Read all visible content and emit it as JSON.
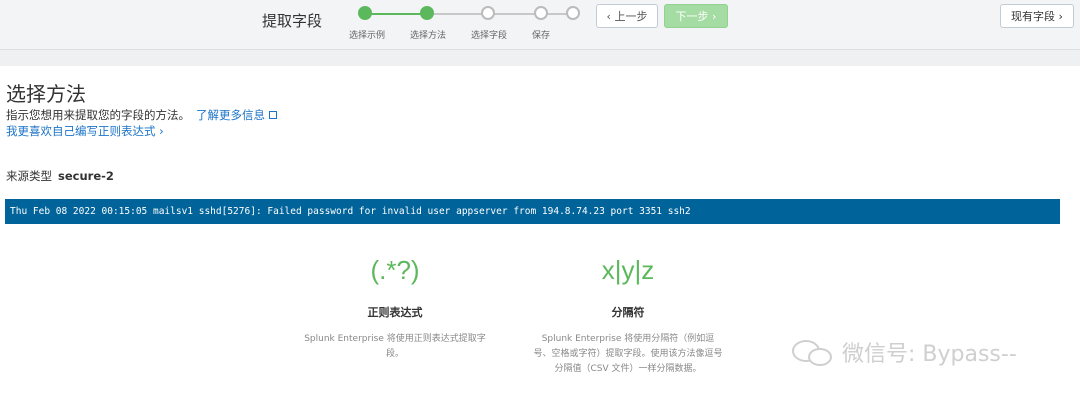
{
  "wizard": {
    "title": "提取字段",
    "steps": [
      {
        "label": "选择示例",
        "done": true
      },
      {
        "label": "选择方法",
        "done": true
      },
      {
        "label": "选择字段",
        "done": false
      },
      {
        "label": "保存",
        "done": false
      }
    ],
    "prev_label": "‹ 上一步",
    "next_label": "下一步 ›",
    "existing_fields_label": "现有字段 ›"
  },
  "page": {
    "title": "选择方法",
    "description": "指示您想用来提取您的字段的方法。",
    "learn_more": "了解更多信息",
    "regex_link": "我更喜欢自己编写正则表达式 ›"
  },
  "source": {
    "label": "来源类型",
    "value": "secure-2"
  },
  "sample_event": "Thu Feb 08 2022 00:15:05 mailsv1 sshd[5276]: Failed password for invalid user appserver from 194.8.74.23 port 3351 ssh2",
  "methods": [
    {
      "icon": "(.*?)",
      "name": "正则表达式",
      "description": "Splunk Enterprise 将使用正则表达式提取字段。"
    },
    {
      "icon": "x|y|z",
      "name": "分隔符",
      "description": "Splunk Enterprise 将使用分隔符（例如逗号、空格或字符）提取字段。使用该方法像逗号分隔值（CSV 文件）一样分隔数据。"
    }
  ],
  "watermark": "微信号: Bypass--",
  "colors": {
    "accent_green": "#5cb85c",
    "link_blue": "#1a73c7",
    "sample_bg": "#00639a"
  }
}
